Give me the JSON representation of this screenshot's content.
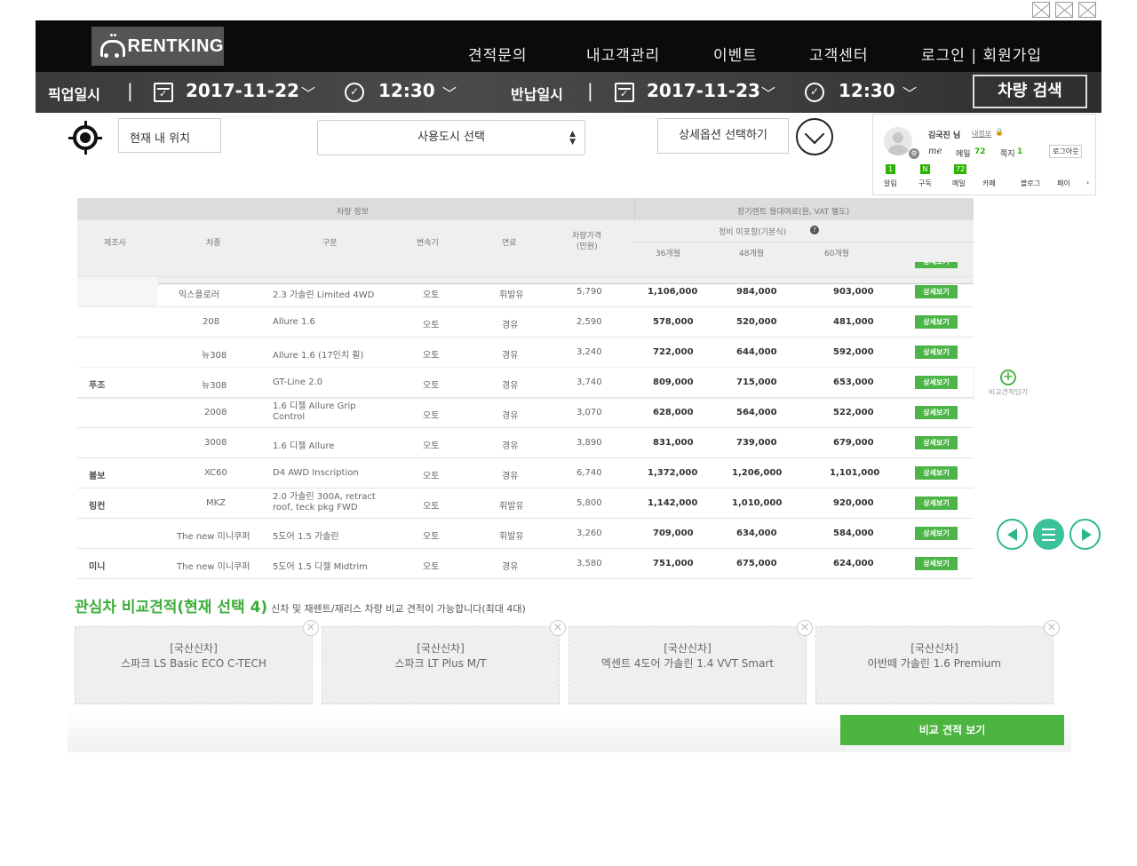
{
  "header": {
    "brand": "RENTKING",
    "nav": [
      "견적문의",
      "내고객관리",
      "이벤트",
      "고객센터",
      "로그인 | 회원가입"
    ]
  },
  "search": {
    "pickup_label": "픽업일시",
    "pickup_date": "2017-11-22",
    "pickup_time": "12:30",
    "return_label": "반납일시",
    "return_date": "2017-11-23",
    "return_time": "12:30",
    "search_button": "차량 검색",
    "separator": "|"
  },
  "filters": {
    "current_location": "현재 내 위치",
    "city_select": "사용도시 선택",
    "detail_option": "상세옵션 선택하기"
  },
  "widget": {
    "user_name": "김국진 님",
    "my_info": "내정보",
    "me_label": "me",
    "mail_label": "메일",
    "mail_count": "72",
    "note_label": "쪽지",
    "note_count": "1",
    "logout": "로그아웃",
    "tabs": [
      {
        "label": "알림",
        "badge": "1"
      },
      {
        "label": "구독",
        "badge": "N"
      },
      {
        "label": "메일",
        "badge": "72"
      },
      {
        "label": "카페",
        "badge": ""
      },
      {
        "label": "블로그",
        "badge": ""
      },
      {
        "label": "페이",
        "badge": ""
      }
    ]
  },
  "table": {
    "group_vehicle": "차량 정보",
    "group_price": "장기렌트 월대여료(원, VAT 별도)",
    "maint_label": "정비 미포함(기본식)",
    "headers": {
      "maker": "제조사",
      "model": "차종",
      "trim": "구분",
      "trans": "변속기",
      "fuel": "연료",
      "price": "차량가격",
      "price_unit": "(만원)",
      "m36": "36개월",
      "m48": "48개월",
      "m60": "60개월"
    },
    "detail_label": "상세보기",
    "rows": [
      {
        "model": "익스플로러",
        "trim": "2.3 가솔린 Limited 4WD",
        "trans": "오토",
        "fuel": "휘발유",
        "price": "5,790",
        "m36": "1,106,000",
        "m48": "984,000",
        "m60": "903,000"
      },
      {
        "model": "208",
        "trim": "Allure 1.6",
        "trans": "오토",
        "fuel": "경유",
        "price": "2,590",
        "m36": "578,000",
        "m48": "520,000",
        "m60": "481,000"
      },
      {
        "model": "뉴308",
        "trim": "Allure 1.6 (17인치 휠)",
        "trans": "오토",
        "fuel": "경유",
        "price": "3,240",
        "m36": "722,000",
        "m48": "644,000",
        "m60": "592,000"
      },
      {
        "model": "뉴308",
        "trim": "GT-Line 2.0",
        "trans": "오토",
        "fuel": "경유",
        "price": "3,740",
        "m36": "809,000",
        "m48": "715,000",
        "m60": "653,000"
      },
      {
        "model": "2008",
        "trim": "1.6 디젤 Allure Grip Control",
        "trans": "오토",
        "fuel": "경유",
        "price": "3,070",
        "m36": "628,000",
        "m48": "564,000",
        "m60": "522,000"
      },
      {
        "model": "3008",
        "trim": "1.6 디젤 Allure",
        "trans": "오토",
        "fuel": "경유",
        "price": "3,890",
        "m36": "831,000",
        "m48": "739,000",
        "m60": "679,000"
      },
      {
        "model": "XC60",
        "trim": "D4 AWD Inscription",
        "trans": "오토",
        "fuel": "경유",
        "price": "6,740",
        "m36": "1,372,000",
        "m48": "1,206,000",
        "m60": "1,101,000"
      },
      {
        "model": "MKZ",
        "trim": "2.0 가솔린 300A, retract roof, teck pkg FWD",
        "trans": "오토",
        "fuel": "휘발유",
        "price": "5,800",
        "m36": "1,142,000",
        "m48": "1,010,000",
        "m60": "920,000"
      },
      {
        "model": "The new 미니쿠퍼",
        "trim": "5도어 1.5 가솔린",
        "trans": "오토",
        "fuel": "휘발유",
        "price": "3,260",
        "m36": "709,000",
        "m48": "634,000",
        "m60": "584,000"
      },
      {
        "model": "The new 미니쿠퍼",
        "trim": "5도어 1.5 디젤 Midtrim",
        "trans": "오토",
        "fuel": "경유",
        "price": "3,580",
        "m36": "751,000",
        "m48": "675,000",
        "m60": "624,000"
      }
    ],
    "makers": [
      "푸조",
      "볼보",
      "링컨",
      "미니"
    ],
    "compare_add": "비교견적담기"
  },
  "compare": {
    "title": "관심차 비교견적(현재 선택 4)",
    "subtitle": "신차 및 재렌트/재리스 차량 비교 견적이 가능합니다(최대 4대)",
    "items": [
      {
        "category": "[국산신차]",
        "name": "스파크 LS Basic ECO C-TECH"
      },
      {
        "category": "[국산신차]",
        "name": "스파크 LT Plus M/T"
      },
      {
        "category": "[국산신차]",
        "name": "엑센트 4도어 가솔린 1.4 VVT Smart"
      },
      {
        "category": "[국산신차]",
        "name": "아반떼 가솔린 1.6 Premium"
      }
    ],
    "button": "비교 견적 보기"
  }
}
